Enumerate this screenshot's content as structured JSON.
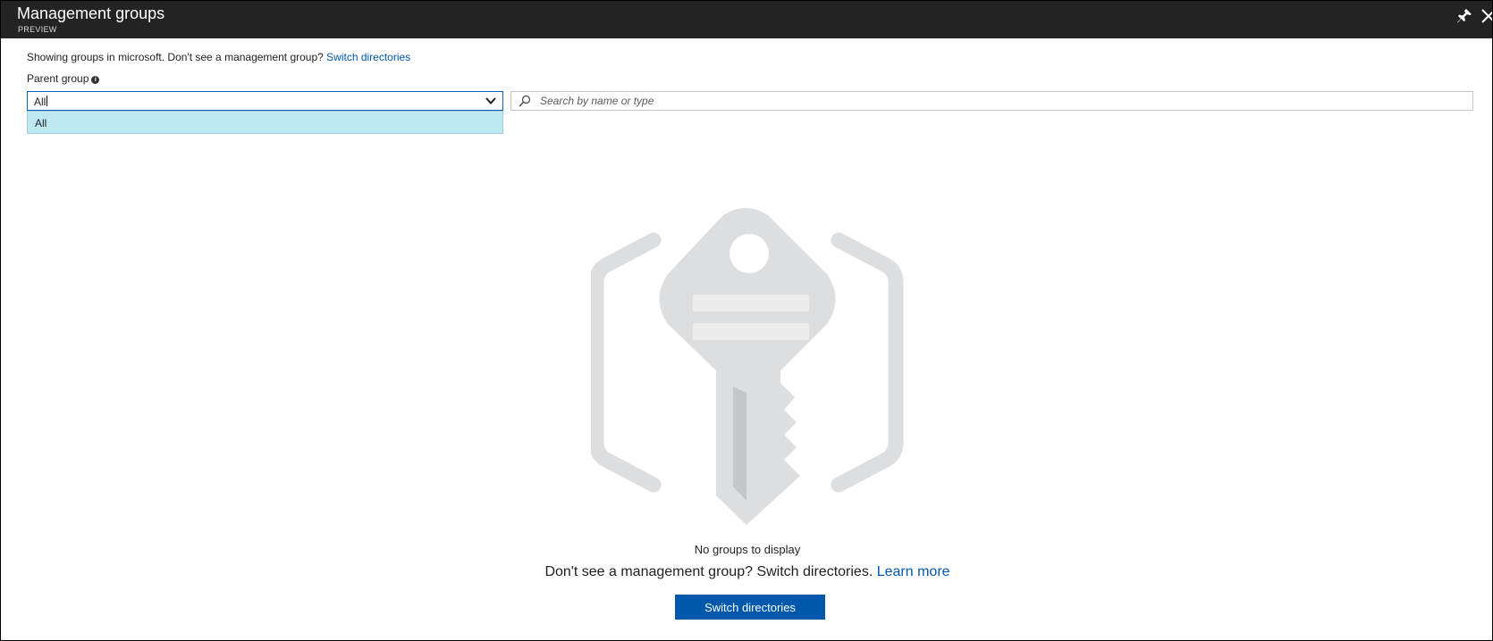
{
  "header": {
    "title": "Management groups",
    "subtitle": "PREVIEW",
    "pin_icon": "pin-icon",
    "close_icon": "close-icon"
  },
  "info": {
    "text": "Showing groups in microsoft. Don't see a management group?",
    "link": "Switch directories"
  },
  "filter": {
    "label": "Parent group",
    "info_icon": "info-icon",
    "value": "All",
    "options": [
      "All"
    ]
  },
  "search": {
    "placeholder": "Search by name or type",
    "value": ""
  },
  "empty_state": {
    "illustration": "key-icon",
    "title": "No groups to display",
    "message": "Don't see a management group? Switch directories.",
    "learn_more": "Learn more",
    "button": "Switch directories"
  },
  "colors": {
    "titlebar": "#232323",
    "accent": "#0058ad",
    "dropdown_highlight": "#bfe8f5",
    "illustration": "#dcdee0"
  }
}
